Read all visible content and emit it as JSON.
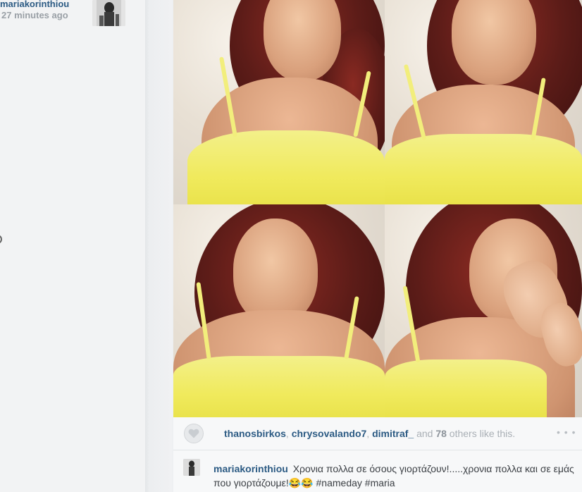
{
  "owner": {
    "username": "mariakorinthiou",
    "time_ago": "27 minutes ago"
  },
  "likes": {
    "users": [
      "thanosbirkos",
      "chrysovalando7",
      "dimitraf_"
    ],
    "separator": ", ",
    "and_word": " and ",
    "others_count": "78",
    "others_suffix": " others like this."
  },
  "caption": {
    "username": "mariakorinthiou",
    "text": "Χρονια πολλα σε όσους γιορτάζουν!.....χρονια πολλα και σε εμάς που γιορτάζουμε!😂😂 #nameday #maria"
  },
  "icons": {
    "heart": "heart-icon",
    "more": "more-dots-icon"
  },
  "colors": {
    "username": "#2b5a83",
    "muted": "#a9afb5",
    "top_yellow": "#f0ea5d",
    "hair": "#5c1c18"
  }
}
